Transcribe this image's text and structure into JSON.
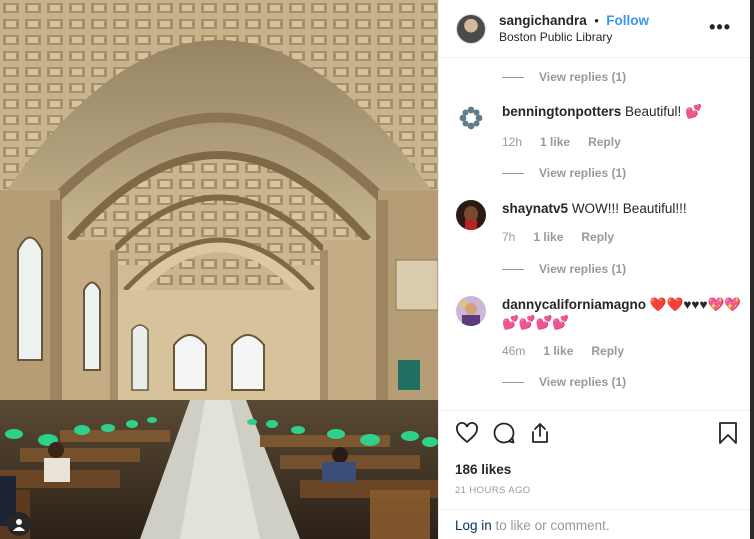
{
  "post": {
    "username": "sangichandra",
    "separator": "•",
    "follow_label": "Follow",
    "location": "Boston Public Library",
    "more_label": "•••"
  },
  "comments": [
    {
      "user": "benningtonpotters",
      "text": "Beautiful! 💕",
      "age": "12h",
      "likes": "1 like",
      "reply": "Reply"
    },
    {
      "user": "shaynatv5",
      "text": "WOW!!! Beautiful!!!",
      "age": "7h",
      "likes": "1 like",
      "reply": "Reply"
    },
    {
      "user": "dannycalifornia­magno",
      "text": "❤️❤️♥♥♥💖💖 💕💕💕💕",
      "age": "46m",
      "likes": "1 like",
      "reply": "Reply"
    }
  ],
  "view_replies": [
    "View replies (1)",
    "View replies (1)",
    "View replies (1)",
    "View replies (1)"
  ],
  "actions": {
    "likes": "186 likes",
    "timestamp": "21 HOURS AGO",
    "login_link": "Log in",
    "login_text": " to like or comment."
  },
  "icons": [
    "heart-icon",
    "comment-icon",
    "share-icon",
    "bookmark-icon",
    "more-icon",
    "user-icon"
  ],
  "colors": {
    "accent": "#3897f0",
    "muted": "#999999",
    "link_dark": "#003569",
    "lamp_green": "#2fd08a"
  }
}
